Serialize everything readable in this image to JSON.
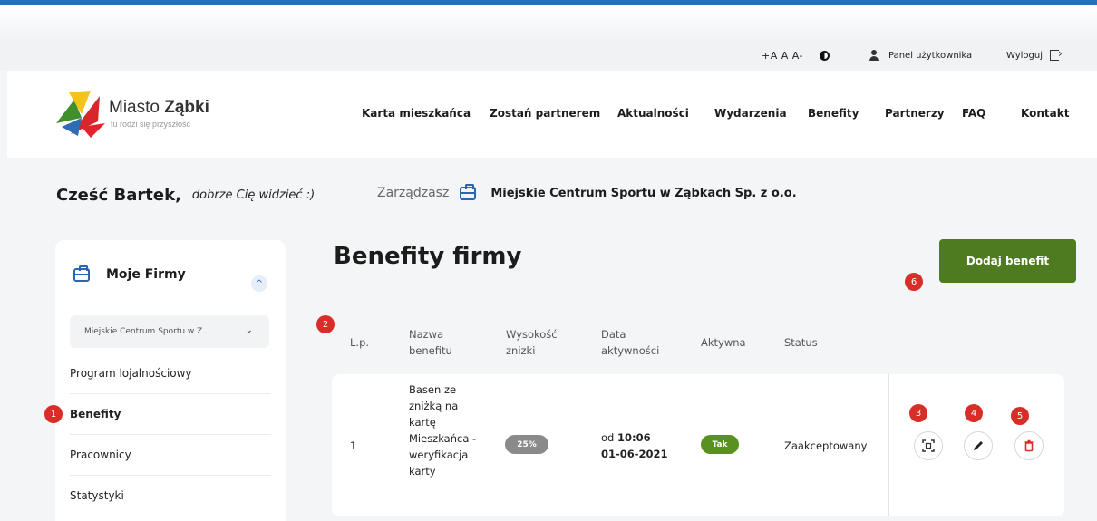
{
  "util": {
    "font_size": "+A A A-",
    "user_panel": "Panel użytkownika",
    "logout": "Wyloguj"
  },
  "header": {
    "logo_name": "Miasto",
    "logo_name_bold": "Ząbki",
    "logo_tagline": "tu rodzi się przyszłość",
    "nav": [
      "Karta mieszkańca",
      "Zostań partnerem",
      "Aktualności",
      "Wydarzenia",
      "Benefity",
      "Partnerzy",
      "FAQ",
      "Kontakt"
    ]
  },
  "greeting": {
    "hello": "Cześć Bartek,",
    "sub": "dobrze Cię widzieć :)",
    "manage_label": "Zarządzasz",
    "company": "Miejskie Centrum Sportu w Ząbkach Sp. z o.o."
  },
  "sidebar": {
    "title": "Moje Firmy",
    "select_value": "Miejskie Centrum Sportu w Z...",
    "items": [
      "Program lojalnościowy",
      "Benefity",
      "Pracownicy",
      "Statystyki"
    ],
    "active": "Benefity"
  },
  "main": {
    "title": "Benefity firmy",
    "add_button": "Dodaj benefit",
    "columns": [
      "L.p.",
      "Nazwa benefitu",
      "Wysokość znizki",
      "Data aktywności",
      "Aktywna",
      "Status"
    ],
    "rows": [
      {
        "lp": "1",
        "name": "Basen ze zniżką na kartę Mieszkańca - weryfikacja karty",
        "discount": "25%",
        "date_prefix": "od",
        "time": "10:06",
        "date": "01-06-2021",
        "active": "Tak",
        "status": "Zaakceptowany"
      }
    ]
  },
  "annotations": [
    "1",
    "2",
    "3",
    "4",
    "5",
    "6"
  ],
  "colors": {
    "primary_blue": "#2a67b3",
    "button_green": "#4e7b1f",
    "active_green": "#58911f",
    "badge_red": "#d92d27",
    "discount_gray": "#8a8a8a"
  }
}
